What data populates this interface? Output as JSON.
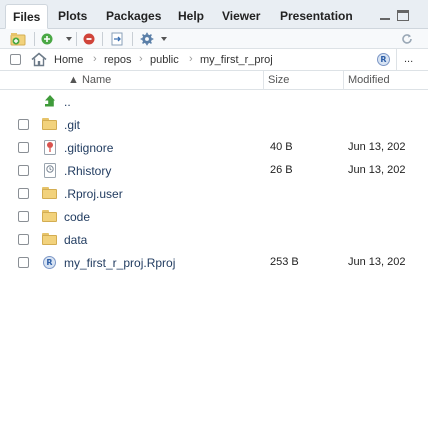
{
  "tabs": [
    "Files",
    "Plots",
    "Packages",
    "Help",
    "Viewer",
    "Presentation"
  ],
  "toolbar": {
    "new_folder_icon": "new-folder-icon",
    "new_file_icon": "new-blank-file-icon",
    "delete_icon": "delete-file-icon",
    "rename_icon": "rename-file-icon",
    "more_icon": "gear-icon",
    "refresh_icon": "refresh-icon"
  },
  "breadcrumb": {
    "items": [
      "Home",
      "repos",
      "public",
      "my_first_r_proj"
    ],
    "separator": "›",
    "overflow_label": "..."
  },
  "table": {
    "headers": {
      "name": "▲ Name",
      "size": "Size",
      "modified": "Modified"
    },
    "parent_label": "..",
    "rows": [
      {
        "name": ".git",
        "size": "",
        "modified": "",
        "icon": "folder"
      },
      {
        "name": ".gitignore",
        "size": "40 B",
        "modified": "Jun 13, 202",
        "icon": "gitignore-file"
      },
      {
        "name": ".Rhistory",
        "size": "26 B",
        "modified": "Jun 13, 202",
        "icon": "history-file"
      },
      {
        "name": ".Rproj.user",
        "size": "",
        "modified": "",
        "icon": "folder"
      },
      {
        "name": "code",
        "size": "",
        "modified": "",
        "icon": "folder"
      },
      {
        "name": "data",
        "size": "",
        "modified": "",
        "icon": "folder"
      },
      {
        "name": "my_first_r_proj.Rproj",
        "size": "253 B",
        "modified": "Jun 13, 202",
        "icon": "rproj-file"
      }
    ]
  },
  "colors": {
    "tabbar_bg": "#e9eef3",
    "folder": "#f2d27c",
    "link": "#1f3a5f",
    "up_arrow": "#3f9b3a"
  }
}
